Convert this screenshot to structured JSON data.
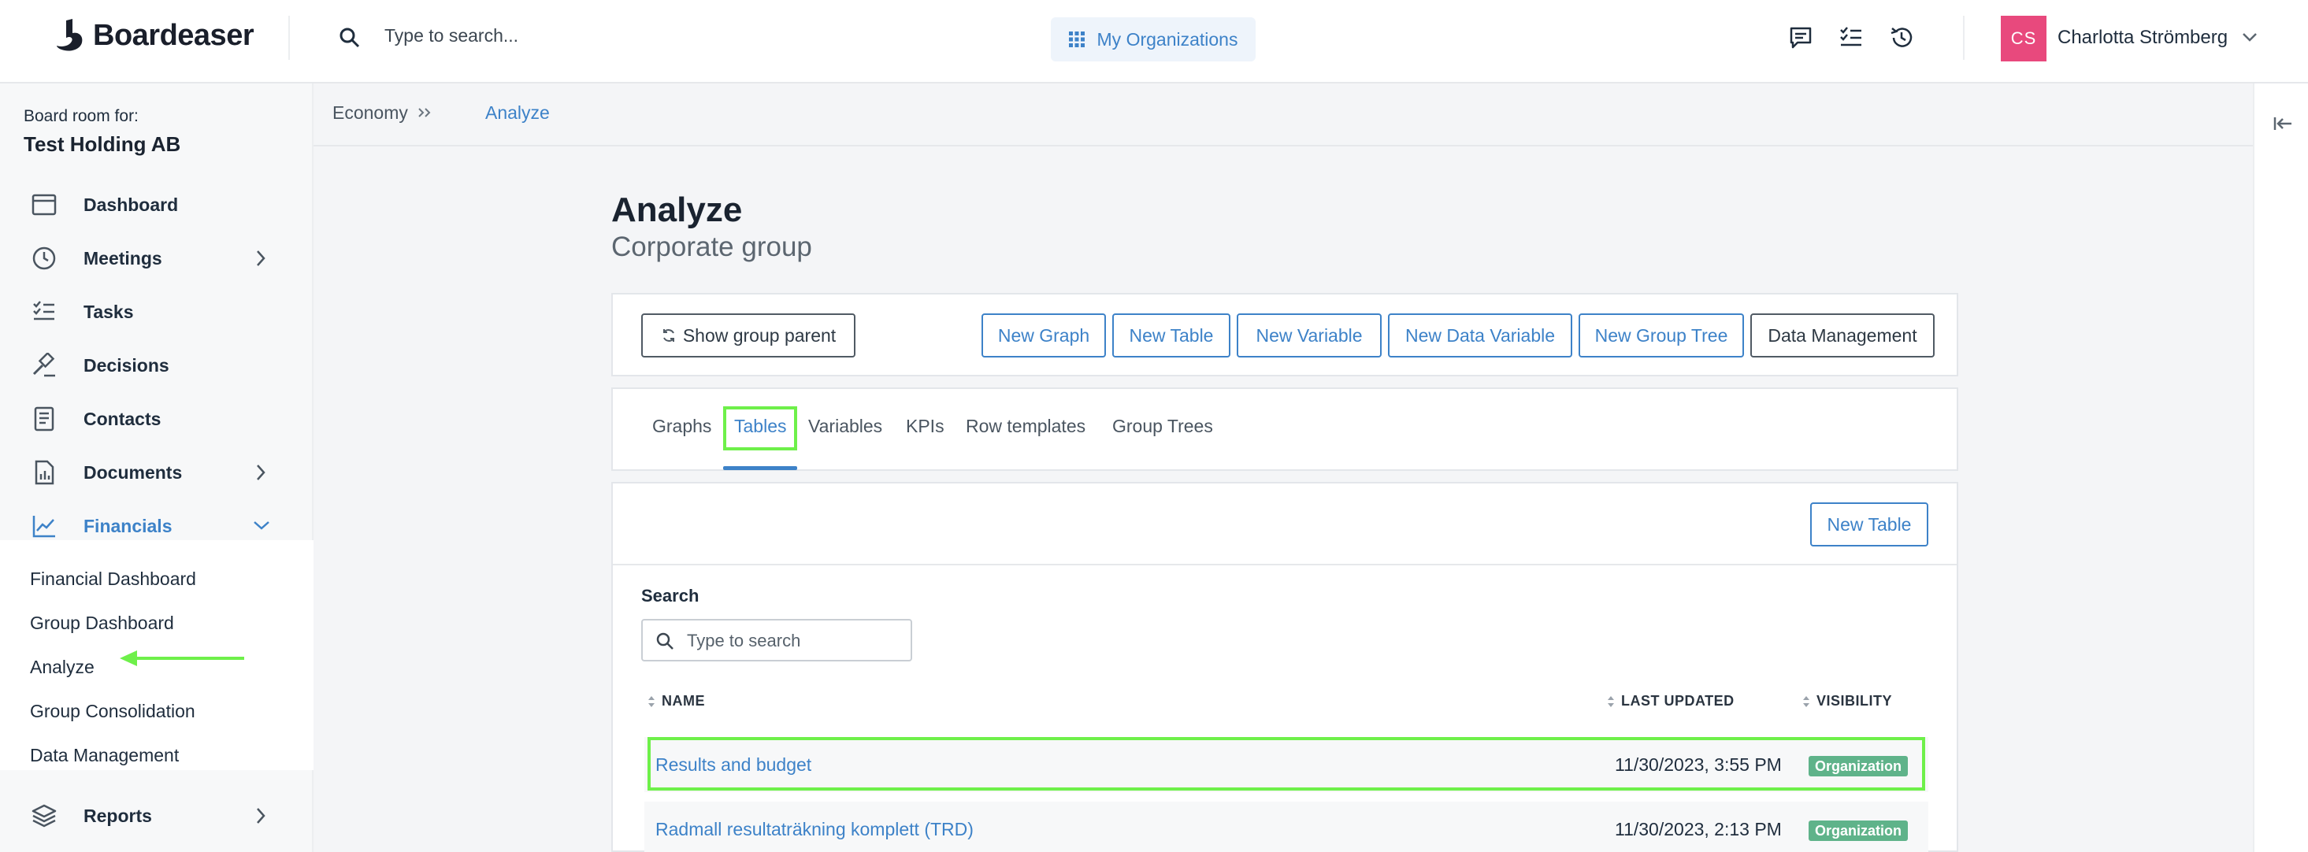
{
  "header": {
    "logo_text": "Boardeaser",
    "search_placeholder": "Type to search...",
    "org_button": "My Organizations",
    "user_initials": "CS",
    "user_name": "Charlotta Strömberg",
    "accent_color": "#3d82c8"
  },
  "sidebar": {
    "board_label": "Board room for:",
    "board_name": "Test Holding AB",
    "items": [
      {
        "label": "Dashboard",
        "icon": "calendar-icon"
      },
      {
        "label": "Meetings",
        "icon": "clock-icon"
      },
      {
        "label": "Tasks",
        "icon": "checklist-icon"
      },
      {
        "label": "Decisions",
        "icon": "gavel-icon"
      },
      {
        "label": "Contacts",
        "icon": "address-book-icon"
      },
      {
        "label": "Documents",
        "icon": "document-icon"
      },
      {
        "label": "Financials",
        "icon": "chart-line-icon"
      },
      {
        "label": "Reports",
        "icon": "layers-icon"
      }
    ],
    "financials_sub": [
      "Financial Dashboard",
      "Group Dashboard",
      "Analyze",
      "Group Consolidation",
      "Data Management"
    ]
  },
  "breadcrumb": {
    "parent": "Economy",
    "current": "Analyze"
  },
  "page": {
    "title": "Analyze",
    "subtitle": "Corporate group"
  },
  "actions": {
    "show_group_parent": "Show group parent",
    "new_graph": "New Graph",
    "new_table": "New Table",
    "new_variable": "New Variable",
    "new_data_variable": "New Data Variable",
    "new_group_tree": "New Group Tree",
    "data_management": "Data Management"
  },
  "tabs": [
    "Graphs",
    "Tables",
    "Variables",
    "KPIs",
    "Row templates",
    "Group Trees"
  ],
  "table_section": {
    "new_table": "New Table",
    "search_label": "Search",
    "search_placeholder": "Type to search",
    "columns": [
      "NAME",
      "LAST UPDATED",
      "VISIBILITY"
    ],
    "rows": [
      {
        "name": "Results and budget",
        "updated": "11/30/2023, 3:55 PM",
        "visibility": "Organization"
      },
      {
        "name": "Radmall resultaträkning komplett (TRD)",
        "updated": "11/30/2023, 2:13 PM",
        "visibility": "Organization"
      }
    ]
  }
}
